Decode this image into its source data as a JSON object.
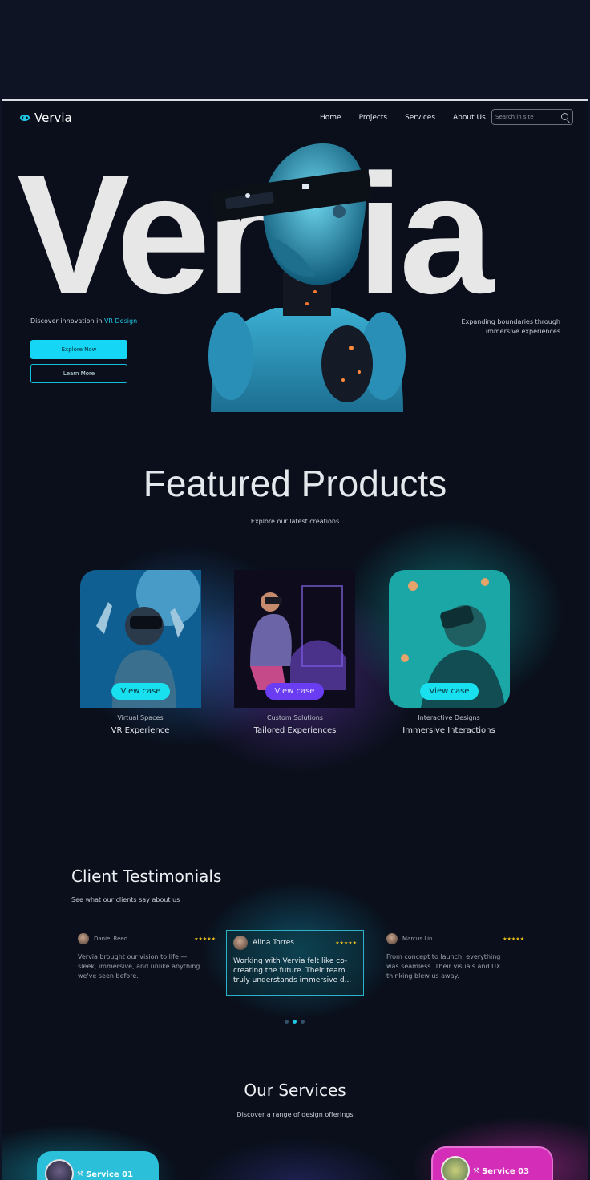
{
  "brand": {
    "name": "Vervia",
    "accent": "#22c7e6"
  },
  "nav": {
    "items": [
      "Home",
      "Projects",
      "Services",
      "About Us"
    ]
  },
  "search": {
    "placeholder": "Search in site"
  },
  "hero": {
    "big_word": "Vervia",
    "tagline_prefix": "Discover innovation in ",
    "tagline_accent": "VR Design",
    "explore_button": "Explore Now",
    "learn_button": "Learn More",
    "right_text_line1": "Expanding boundaries through",
    "right_text_line2": "immersive experiences"
  },
  "featured": {
    "title": "Featured Products",
    "subtitle": "Explore our latest creations",
    "cards": [
      {
        "button": "View case",
        "category": "Virtual Spaces",
        "name": "VR Experience"
      },
      {
        "button": "View case",
        "category": "Custom Solutions",
        "name": "Tailored Experiences"
      },
      {
        "button": "View case",
        "category": "Interactive Designs",
        "name": "Immersive Interactions"
      }
    ]
  },
  "testimonials": {
    "title": "Client Testimonials",
    "subtitle": "See what our clients say about us",
    "items": [
      {
        "name": "Daniel Reed",
        "stars": "★★★★★",
        "line1": "Vervia brought our vision to life —",
        "line2": "sleek, immersive, and unlike anything",
        "line3": "we've seen before."
      },
      {
        "name": "Alina Torres",
        "stars": "★★★★★",
        "line1": "Working with Vervia felt like co-",
        "line2": "creating the future. Their team",
        "line3": "truly understands immersive d..."
      },
      {
        "name": "Marcus Lin",
        "stars": "★★★★★",
        "line1": "From concept to launch, everything",
        "line2": "was seamless. Their visuals and UX",
        "line3": "thinking blew us away."
      }
    ],
    "active_index": 1
  },
  "services": {
    "title": "Our Services",
    "subtitle": "Discover a range of design offerings",
    "items": [
      {
        "tool_icon": "⚒",
        "label": "Service 01",
        "color": "#2bbfd9"
      },
      {
        "tool_icon": "⚒",
        "label": "Service 03",
        "color": "#d42eb9"
      }
    ]
  }
}
